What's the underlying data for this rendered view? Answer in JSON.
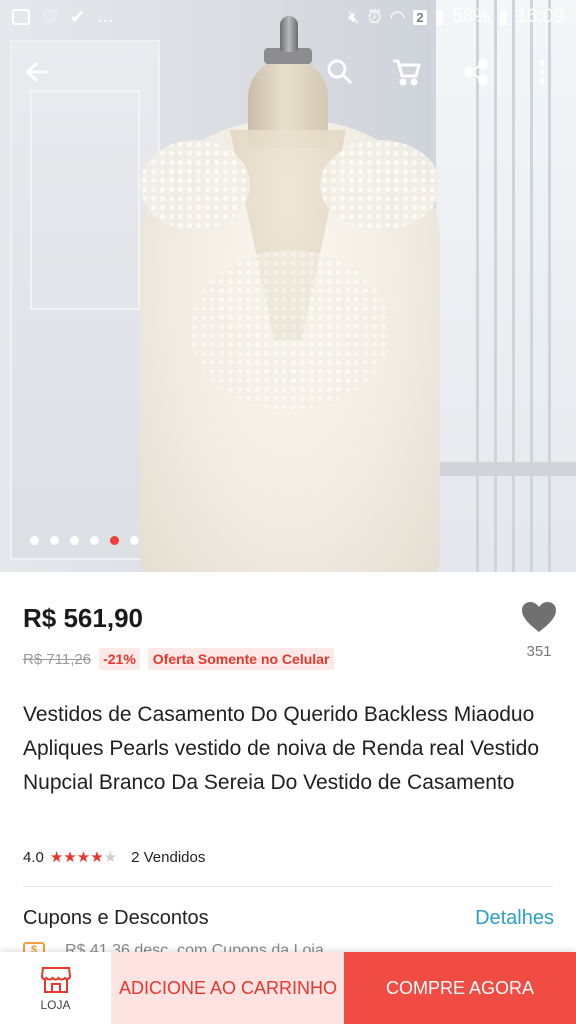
{
  "status_bar": {
    "left_icons": [
      "image-icon",
      "heart-icon",
      "check-icon"
    ],
    "ellipsis": "...",
    "right_icons": [
      "mute-icon",
      "alarm-icon",
      "wifi-icon",
      "sim-icon",
      "signal-icon"
    ],
    "sim_badge": "2",
    "battery": "58%",
    "time": "16:09"
  },
  "toolbar": {
    "icons": [
      "back-arrow-icon",
      "search-icon",
      "cart-icon",
      "share-icon",
      "more-icon"
    ]
  },
  "gallery": {
    "total_images": 6,
    "active_index": 4
  },
  "product": {
    "price": "R$ 561,90",
    "original_price": "R$ 711,26",
    "discount": "-21%",
    "offer_badge": "Oferta Somente no Celular",
    "wishlist_count": "351",
    "title": "Vestidos de Casamento Do Querido Backless Miaoduo Apliques Pearls vestido de noiva de Renda real Vestido Nupcial Branco Da Sereia Do Vestido de Casamento",
    "rating": "4.0",
    "rating_stars": 4,
    "rating_max": 5,
    "sold": "2 Vendidos"
  },
  "coupons": {
    "title": "Cupons e Descontos",
    "details_link": "Detalhes",
    "peek_icon": "$",
    "peek_text": "R$ 41,36 desc. com Cupons da Loja"
  },
  "bottom_bar": {
    "store_label": "LOJA",
    "add_to_cart": "ADICIONE AO CARRINHO",
    "buy_now": "COMPRE AGORA"
  },
  "colors": {
    "accent": "#e8362c",
    "link": "#2c9fc8",
    "buy_button": "#f04c44",
    "cart_button_bg": "#fde3e1"
  }
}
